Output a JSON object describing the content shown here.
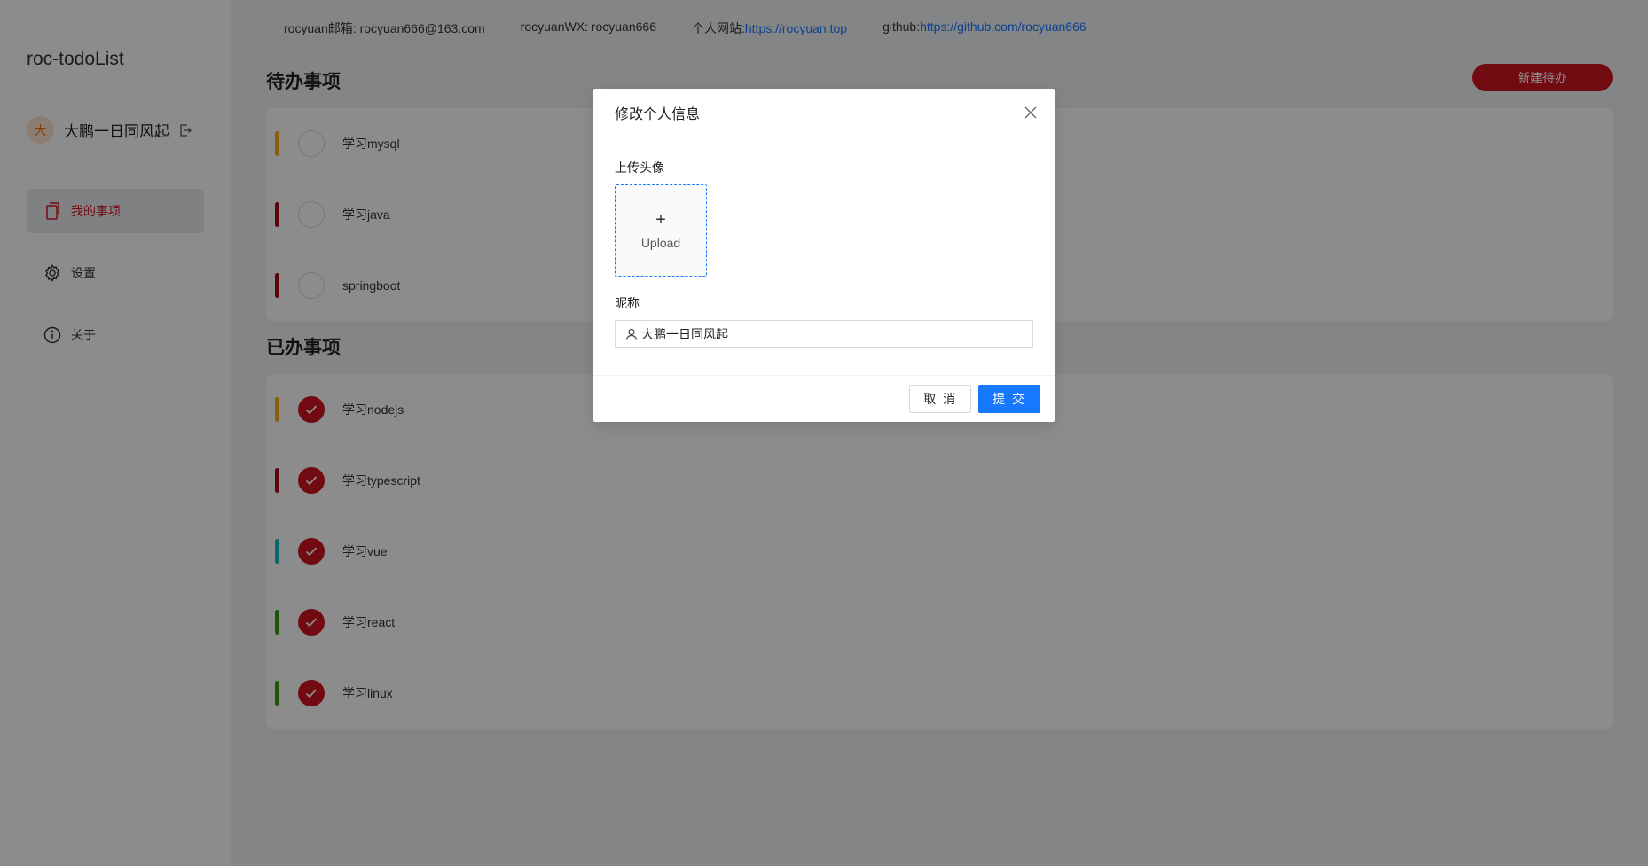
{
  "sidebar": {
    "app_title": "roc-todoList",
    "user": {
      "avatar_initial": "大",
      "name": "大鹏一日同风起"
    },
    "items": [
      {
        "label": "我的事项",
        "icon": "document-icon"
      },
      {
        "label": "设置",
        "icon": "gear-icon"
      },
      {
        "label": "关于",
        "icon": "info-icon"
      }
    ]
  },
  "topinfo": {
    "email_label": "rocyuan邮箱: rocyuan666@163.com",
    "wx_label": "rocyuanWX: rocyuan666",
    "site_prefix": "个人网站:",
    "site_url": "https://rocyuan.top",
    "github_prefix": "github:",
    "github_url": "https://github.com/rocyuan666"
  },
  "pending": {
    "title": "待办事项",
    "new_button": "新建待办",
    "tasks": [
      {
        "label": "学习mysql",
        "color": "#faad14",
        "done": false
      },
      {
        "label": "学习java",
        "color": "#a8071a",
        "done": false
      },
      {
        "label": "springboot",
        "color": "#a8071a",
        "done": false
      }
    ]
  },
  "completed": {
    "title": "已办事项",
    "tasks": [
      {
        "label": "学习nodejs",
        "color": "#faad14",
        "done": true
      },
      {
        "label": "学习typescript",
        "color": "#a8071a",
        "done": true
      },
      {
        "label": "学习vue",
        "color": "#13c2c2",
        "done": true
      },
      {
        "label": "学习react",
        "color": "#389e0d",
        "done": true
      },
      {
        "label": "学习linux",
        "color": "#389e0d",
        "done": true
      }
    ]
  },
  "modal": {
    "title": "修改个人信息",
    "avatar_label": "上传头像",
    "upload_text": "Upload",
    "nickname_label": "昵称",
    "nickname_value": "大鹏一日同风起",
    "cancel_label": "取 消",
    "submit_label": "提 交"
  },
  "colors": {
    "brand": "#cf1322",
    "primary": "#1677ff"
  }
}
